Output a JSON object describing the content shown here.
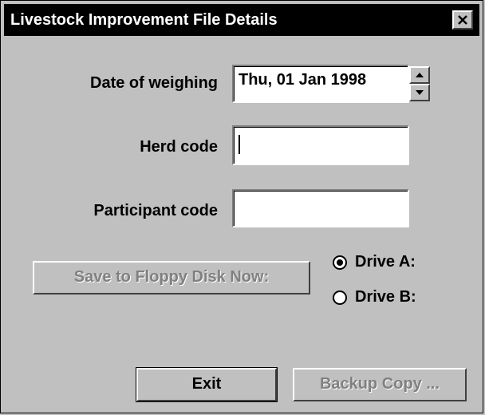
{
  "window": {
    "title": "Livestock Improvement File Details"
  },
  "fields": {
    "date_label": "Date of weighing",
    "date_value": "Thu, 01 Jan 1998",
    "herd_label": "Herd code",
    "herd_value": "",
    "participant_label": "Participant code",
    "participant_value": ""
  },
  "save_button": {
    "label": "Save to Floppy Disk Now:",
    "enabled": false
  },
  "drives": [
    {
      "label": "Drive A:",
      "selected": true
    },
    {
      "label": "Drive B:",
      "selected": false
    }
  ],
  "buttons": {
    "exit": "Exit",
    "backup": "Backup Copy ...",
    "backup_enabled": false
  },
  "icons": {
    "close": "close-icon",
    "spin_up": "arrow-up-icon",
    "spin_down": "arrow-down-icon"
  }
}
